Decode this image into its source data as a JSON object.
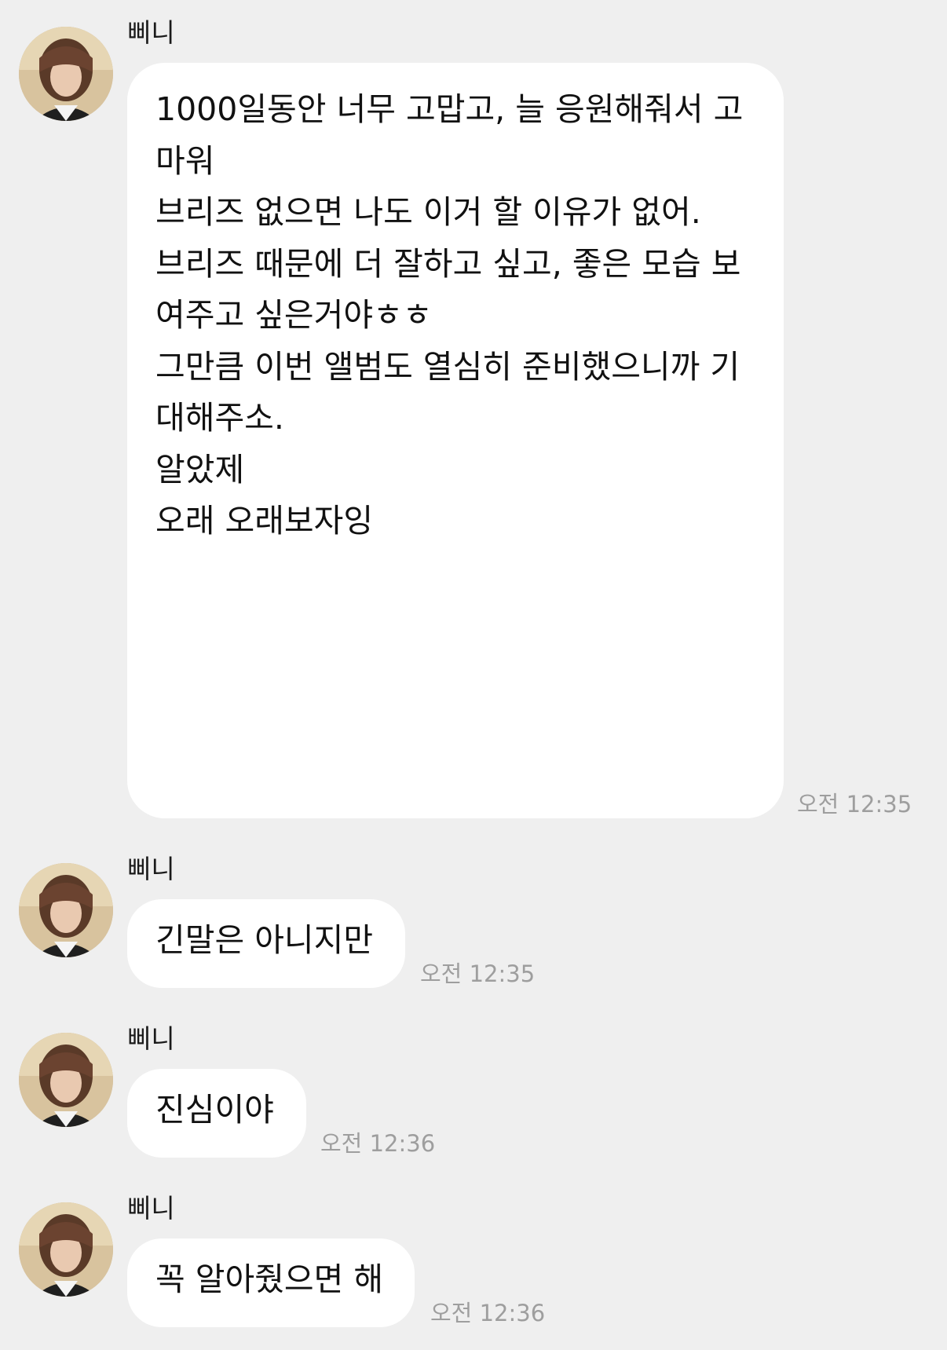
{
  "messages": [
    {
      "sender": "삐니",
      "lines": [
        "1000일동안 너무 고맙고, 늘 응원해줘서 고",
        "마워",
        "브리즈 없으면 나도 이거 할 이유가 없어.",
        "브리즈 때문에 더 잘하고 싶고, 좋은 모습 보",
        "여주고 싶은거야ㅎㅎ",
        "그만큼 이번 앨범도 열심히 준비했으니까 기",
        "대해주소.",
        "알았제",
        "오래 오래보자잉"
      ],
      "time": "오전 12:35"
    },
    {
      "sender": "삐니",
      "text": "긴말은 아니지만",
      "time": "오전 12:35"
    },
    {
      "sender": "삐니",
      "text": "진심이야",
      "time": "오전 12:36"
    },
    {
      "sender": "삐니",
      "text": "꼭 알아줬으면 해",
      "time": "오전 12:36"
    }
  ]
}
